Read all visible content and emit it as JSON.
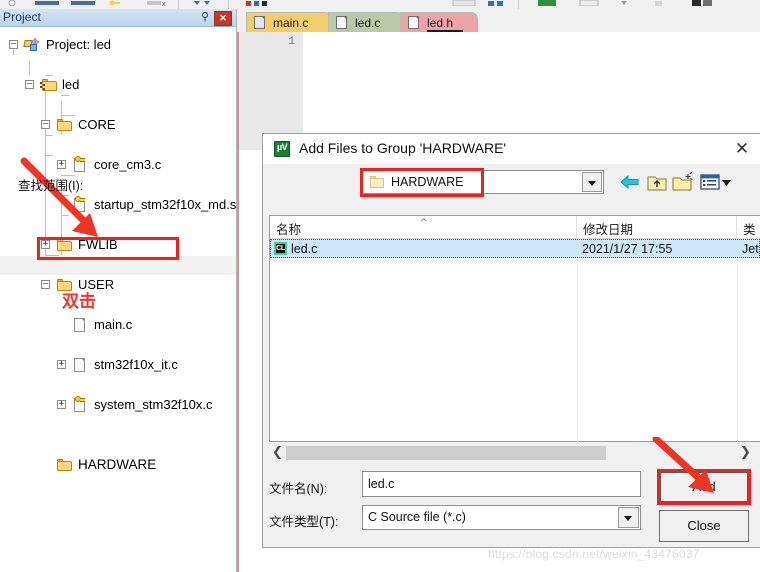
{
  "app": {
    "panel_title": "Project",
    "pin_icon": "pin-icon",
    "close_icon": "x"
  },
  "project_tree": [
    {
      "label": "Project: led",
      "icon": "project-icon",
      "expander": "-",
      "indent": 0
    },
    {
      "label": "led",
      "icon": "group-icon",
      "expander": "-",
      "indent": 1
    },
    {
      "label": "CORE",
      "icon": "folder-icon",
      "expander": "-",
      "indent": 2
    },
    {
      "label": "core_cm3.c",
      "icon": "c-file-icon",
      "expander": "+",
      "indent": 3
    },
    {
      "label": "startup_stm32f10x_md.s",
      "icon": "asm-file-icon",
      "expander": "",
      "indent": 3
    },
    {
      "label": "FWLIB",
      "icon": "folder-icon",
      "expander": "+",
      "indent": 2
    },
    {
      "label": "USER",
      "icon": "folder-icon",
      "expander": "-",
      "indent": 2
    },
    {
      "label": "main.c",
      "icon": "doc-file-icon",
      "expander": "",
      "indent": 3
    },
    {
      "label": "stm32f10x_it.c",
      "icon": "doc-file-icon",
      "expander": "+",
      "indent": 3
    },
    {
      "label": "system_stm32f10x.c",
      "icon": "c-file-icon",
      "expander": "+",
      "indent": 3
    },
    {
      "label": "HARDWARE",
      "icon": "folder-icon",
      "expander": "",
      "indent": 2
    }
  ],
  "annotations": {
    "double_click_note": "双击",
    "highlight_color": "#ee2020",
    "arrow_color": "#ee3423"
  },
  "editor": {
    "tabs": [
      {
        "label": "main.c",
        "color": "#f4cd68",
        "active": false,
        "icon": "doc-hatched-icon"
      },
      {
        "label": "led.c",
        "color": "#b9c9a4",
        "active": false,
        "icon": "doc-icon"
      },
      {
        "label": "led.h",
        "color": "#eda3a6",
        "active": true,
        "icon": "doc-icon"
      }
    ],
    "line_number": "1"
  },
  "dialog": {
    "title": "Add Files to Group 'HARDWARE'",
    "icon": "keil-uvision-icon",
    "close_icon": "✕",
    "look_in": {
      "label": "查找范围(I):",
      "value": "HARDWARE",
      "folder_icon": "folder-icon",
      "dropdown_icon": "chevron-down-icon"
    },
    "nav_icons": [
      {
        "name": "back-arrow-icon",
        "glyph": "⬅"
      },
      {
        "name": "up-folder-icon",
        "glyph": "folder-up"
      },
      {
        "name": "new-folder-icon",
        "glyph": "folder-new"
      },
      {
        "name": "view-mode-icon",
        "glyph": "list-view"
      },
      {
        "name": "view-mode-chevron-icon",
        "glyph": "▼"
      }
    ],
    "columns": [
      {
        "key": "name",
        "label": "名称"
      },
      {
        "key": "date",
        "label": "修改日期"
      },
      {
        "key": "type",
        "label": "类"
      }
    ],
    "sort_indicator": "^",
    "files": [
      {
        "name": "led.c",
        "date": "2021/1/27 17:55",
        "type": "Jet",
        "icon": "cl-source-icon",
        "selected": true
      }
    ],
    "scrollbar": {
      "left_arrow": "❮",
      "right_arrow": "❯"
    },
    "file_name": {
      "label": "文件名(N):",
      "value": "led.c"
    },
    "file_type": {
      "label": "文件类型(T):",
      "value": "C Source file (*.c)",
      "dropdown_icon": "chevron-down-icon"
    },
    "buttons": {
      "add": "Add",
      "close": "Close"
    }
  },
  "watermark": "https://blog.csdn.net/weixin_43476037"
}
